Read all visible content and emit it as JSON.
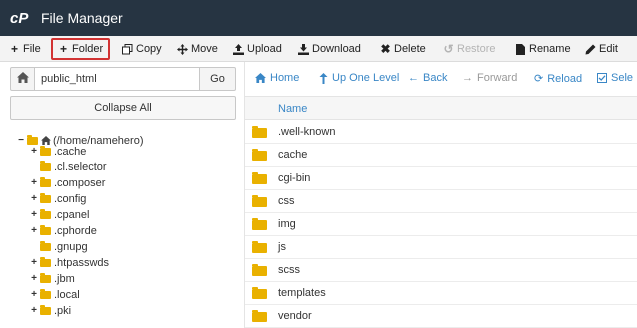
{
  "app": {
    "title": "File Manager",
    "logo_text": "cP"
  },
  "toolbar": {
    "file": "File",
    "folder": "Folder",
    "copy": "Copy",
    "move": "Move",
    "upload": "Upload",
    "download": "Download",
    "delete": "Delete",
    "restore": "Restore",
    "rename": "Rename",
    "edit": "Edit"
  },
  "left_panel": {
    "path_value": "public_html",
    "go_label": "Go",
    "collapse_label": "Collapse All",
    "tree": [
      {
        "label": "(/home/namehero)",
        "expander": "−",
        "root": true
      },
      {
        "label": ".cache",
        "expander": "+"
      },
      {
        "label": ".cl.selector",
        "expander": ""
      },
      {
        "label": ".composer",
        "expander": "+"
      },
      {
        "label": ".config",
        "expander": "+"
      },
      {
        "label": ".cpanel",
        "expander": "+"
      },
      {
        "label": ".cphorde",
        "expander": "+"
      },
      {
        "label": ".gnupg",
        "expander": ""
      },
      {
        "label": ".htpasswds",
        "expander": "+"
      },
      {
        "label": ".jbm",
        "expander": "+"
      },
      {
        "label": ".local",
        "expander": "+"
      },
      {
        "label": ".pki",
        "expander": "+"
      }
    ]
  },
  "nav": {
    "home": "Home",
    "up": "Up One Level",
    "back": "Back",
    "forward": "Forward",
    "reload": "Reload",
    "select": "Sele"
  },
  "list": {
    "name_header": "Name",
    "rows": [
      ".well-known",
      "cache",
      "cgi-bin",
      "css",
      "img",
      "js",
      "scss",
      "templates",
      "vendor"
    ]
  },
  "colors": {
    "header_bg": "#263442",
    "link": "#3a87c6",
    "folder": "#e9b100",
    "highlight": "#d23333"
  }
}
